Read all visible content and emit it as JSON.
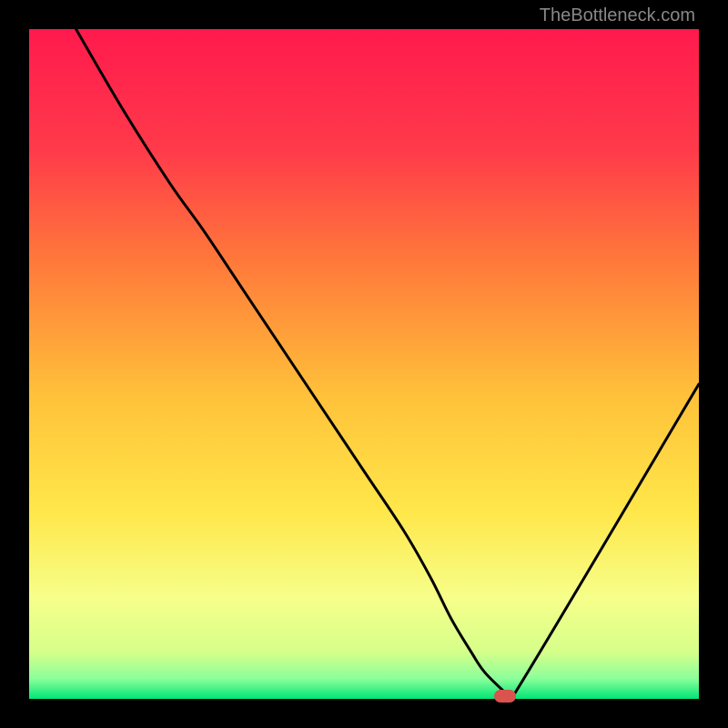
{
  "watermark": "TheBottleneck.com",
  "chart_data": {
    "type": "line",
    "title": "",
    "xlabel": "",
    "ylabel": "",
    "xlim": [
      0,
      100
    ],
    "ylim": [
      0,
      100
    ],
    "series": [
      {
        "name": "curve",
        "x": [
          7,
          14,
          21,
          26,
          32,
          38,
          44,
          50,
          56,
          60,
          63,
          66,
          68,
          71,
          72,
          100
        ],
        "y": [
          100,
          88,
          77,
          70,
          61,
          52,
          43,
          34,
          25,
          18,
          12,
          7,
          4,
          1,
          0,
          47
        ]
      }
    ],
    "marker": {
      "x": 71,
      "y": 0,
      "color": "#d9534f"
    },
    "gradient_colors": {
      "top": "#ff1a4d",
      "mid_upper": "#ff6a3a",
      "mid": "#ffb300",
      "mid_lower": "#ffe74a",
      "low": "#f6ff8a",
      "lower": "#c6ff8a",
      "bottom": "#00e676"
    }
  }
}
